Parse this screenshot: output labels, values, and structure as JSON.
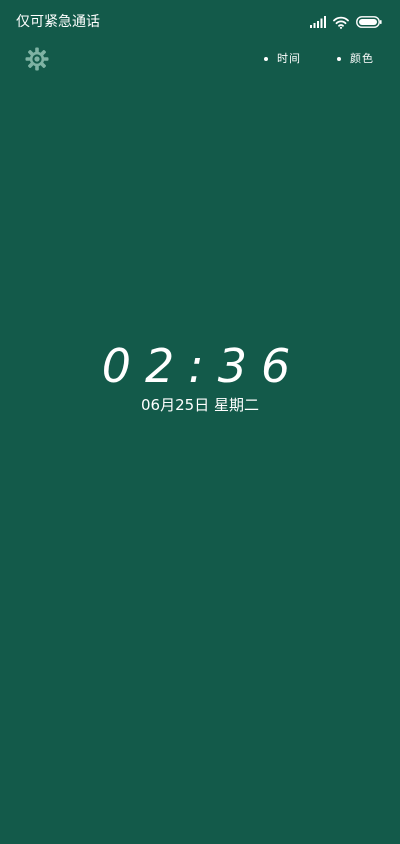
{
  "status_bar": {
    "carrier_text": "仅可紧急通话",
    "icons": [
      "signal-icon",
      "wifi-icon",
      "battery-icon"
    ]
  },
  "toolbar": {
    "settings_icon": "gear-icon",
    "menu": [
      {
        "label": "时间"
      },
      {
        "label": "颜色"
      }
    ]
  },
  "clock": {
    "time": "02:36",
    "date": "06月25日 星期二"
  },
  "colors": {
    "background": "#135A4A",
    "foreground": "#FFFFFF",
    "icon": "#7FB3A4"
  }
}
